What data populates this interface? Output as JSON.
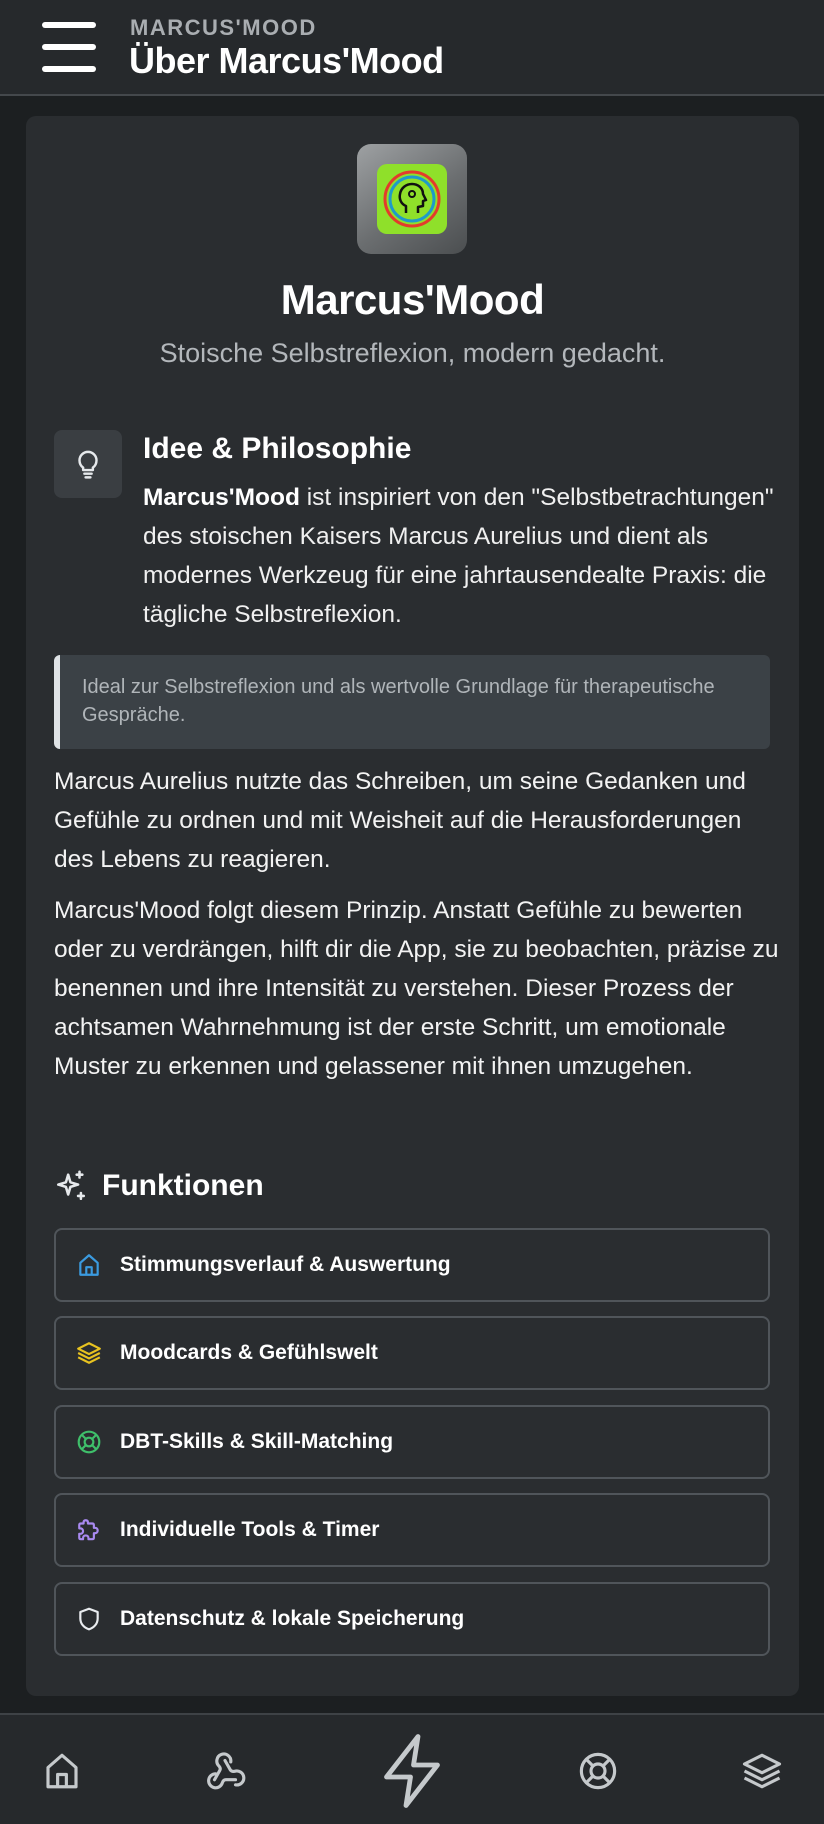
{
  "header": {
    "eyebrow": "MARCUS'MOOD",
    "title": "Über Marcus'Mood",
    "menu_icon": "hamburger-menu-icon"
  },
  "app": {
    "name": "Marcus'Mood",
    "tagline": "Stoische Selbstreflexion, modern gedacht.",
    "icon": "head-profile-logo-icon",
    "icon_colors": {
      "background": "#8fe02a",
      "ring_outer": "#e33b2c",
      "ring_inner": "#1f9ac9"
    }
  },
  "idea": {
    "icon": "lightbulb-icon",
    "title": "Idee & Philosophie",
    "text_bold": "Marcus'Mood",
    "text_rest": " ist inspiriert von den \"Selbstbetrachtungen\" des stoischen Kaisers Marcus Aurelius und dient als modernes Werkzeug für eine jahrtausendealte Praxis: die tägliche Selbstreflexion."
  },
  "quote": "Ideal zur Selbstreflexion und als wertvolle Grundlage für therapeutische Gespräche.",
  "paragraphs": [
    "Marcus Aurelius nutzte das Schreiben, um seine Gedanken und Gefühle zu ordnen und mit Weisheit auf die Herausforderungen des Lebens zu reagieren.",
    "Marcus'Mood folgt diesem Prinzip. Anstatt Gefühle zu bewerten oder zu verdrängen, hilft dir die App, sie zu beobachten, präzise zu benennen und ihre Intensität zu verstehen. Dieser Prozess der achtsamen Wahrnehmung ist der erste Schritt, um emotionale Muster zu erkennen und gelassener mit ihnen umzugehen."
  ],
  "features": {
    "icon": "sparkles-icon",
    "title": "Funktionen",
    "items": [
      {
        "label": "Stimmungsverlauf & Auswertung",
        "icon": "home-icon",
        "color": "#3b9be0"
      },
      {
        "label": "Moodcards & Gefühlswelt",
        "icon": "layers-icon",
        "color": "#e8c320"
      },
      {
        "label": "DBT-Skills & Skill-Matching",
        "icon": "lifebuoy-icon",
        "color": "#3fbf6a"
      },
      {
        "label": "Individuelle Tools & Timer",
        "icon": "puzzle-icon",
        "color": "#a98af0"
      },
      {
        "label": "Datenschutz & lokale Speicherung",
        "icon": "shield-icon",
        "color": "#e9ecef"
      }
    ]
  },
  "bottom_nav": {
    "items": [
      {
        "icon": "home-icon"
      },
      {
        "icon": "webhook-icon"
      },
      {
        "icon": "lightning-bolt-icon"
      },
      {
        "icon": "lifebuoy-icon"
      },
      {
        "icon": "layers-icon"
      }
    ],
    "icon_color": "#c5c9cc"
  }
}
